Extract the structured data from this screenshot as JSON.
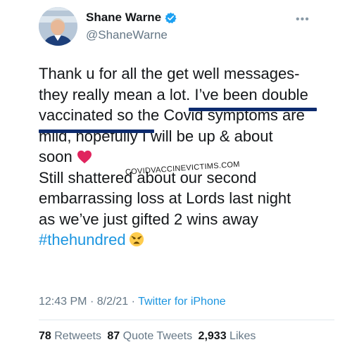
{
  "author": {
    "display_name": "Shane Warne",
    "handle": "@ShaneWarne",
    "verified": true
  },
  "tweet": {
    "lines": [
      "Thank u for all the get well messages-",
      "they really mean a lot. I’ve been double",
      "vaccinated so the Covid symptoms are",
      "mild, hopefully I will be up & about",
      "soon",
      "Still shattered about our second",
      "embarrassing loss at Lords last night",
      "as we’ve just gifted 2 wins away"
    ],
    "hashtag": "#thehundred"
  },
  "watermark": "COVIDVACCINEVICTIMS.COM",
  "meta": {
    "time": "12:43 PM",
    "separator": "·",
    "date": "8/2/21",
    "source": "Twitter for iPhone"
  },
  "stats": {
    "retweets_count": "78",
    "retweets_label": "Retweets",
    "quotes_count": "87",
    "quotes_label": "Quote Tweets",
    "likes_count": "2,933",
    "likes_label": "Likes"
  },
  "colors": {
    "link": "#1b95e0",
    "secondary_text": "#657786",
    "underline_annotation": "#0d2b6e",
    "verified_badge": "#1da1f2"
  },
  "icons": [
    "verified-badge-icon",
    "more-options-icon",
    "red-heart-emoji-icon",
    "weary-face-emoji-icon"
  ]
}
